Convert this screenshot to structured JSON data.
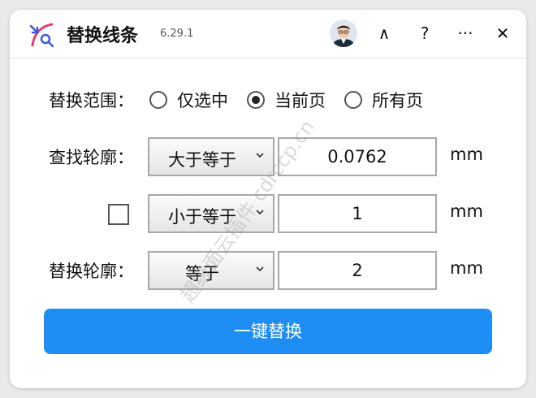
{
  "app": {
    "title": "替换线条",
    "version": "6.29.1",
    "watermark": "超级面云插件 cdrccp.cn"
  },
  "titlebar": {
    "collapse_label": "∧",
    "help_label": "?",
    "more_label": "···",
    "close_label": "✕"
  },
  "scope": {
    "label": "替换范围：",
    "options": [
      {
        "label": "仅选中",
        "checked": false
      },
      {
        "label": "当前页",
        "checked": true
      },
      {
        "label": "所有页",
        "checked": false
      }
    ]
  },
  "find": {
    "label": "查找轮廓：",
    "condition1": {
      "operator": "大于等于",
      "value": "0.0762",
      "unit": "mm"
    },
    "condition2": {
      "enabled": false,
      "operator": "小于等于",
      "value": "1",
      "unit": "mm"
    }
  },
  "replace": {
    "label": "替换轮廓：",
    "operator": "等于",
    "value": "2",
    "unit": "mm"
  },
  "action": {
    "label": "一键替换"
  },
  "colors": {
    "accent": "#1e8ef5",
    "logo_pink": "#e0407a",
    "logo_blue": "#3b5bd6"
  }
}
